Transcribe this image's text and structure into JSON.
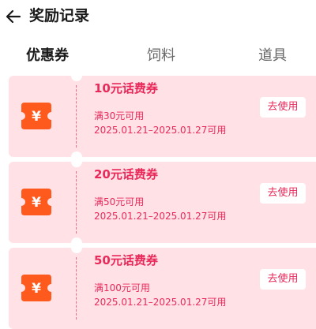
{
  "header": {
    "title": "奖励记录"
  },
  "tabs": [
    {
      "label": "优惠券",
      "active": true
    },
    {
      "label": "饲料",
      "active": false
    },
    {
      "label": "道具",
      "active": false
    }
  ],
  "icons": {
    "back": "arrow-left-icon",
    "ticket": "yuan-ticket-icon",
    "ticket_symbol": "¥"
  },
  "colors": {
    "accent": "#e8295a",
    "card_bg": "#ffe1e6",
    "icon_orange": "#ff5a1e"
  },
  "coupons": [
    {
      "title": "10元话费券",
      "condition": "满30元可用",
      "validity": "2025.01.21–2025.01.27可用",
      "action": "去使用"
    },
    {
      "title": "20元话费券",
      "condition": "满50元可用",
      "validity": "2025.01.21–2025.01.27可用",
      "action": "去使用"
    },
    {
      "title": "50元话费券",
      "condition": "满100元可用",
      "validity": "2025.01.21–2025.01.27可用",
      "action": "去使用"
    }
  ]
}
